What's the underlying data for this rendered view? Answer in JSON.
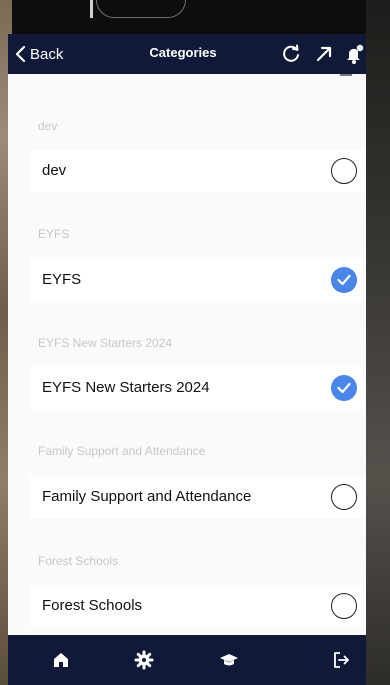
{
  "header": {
    "back_label": "Back",
    "title": "Categories",
    "icons": [
      "refresh-icon",
      "expand-icon",
      "bell-icon"
    ]
  },
  "categories": [
    {
      "section": "dev",
      "label": "dev",
      "selected": false
    },
    {
      "section": "EYFS",
      "label": "EYFS",
      "selected": true
    },
    {
      "section": "EYFS New Starters 2024",
      "label": "EYFS New Starters 2024",
      "selected": true
    },
    {
      "section": "Family Support and Attendance",
      "label": "Family Support and Attendance",
      "selected": false
    },
    {
      "section": "Forest Schools",
      "label": "Forest Schools",
      "selected": false
    }
  ],
  "bottom_nav": [
    "home-icon",
    "gear-icon",
    "graduation-cap-icon",
    "logout-icon"
  ],
  "colors": {
    "header": "#101a38",
    "accent": "#4a86e8",
    "background": "#fafafa",
    "section_label": "#c7c7c7"
  }
}
